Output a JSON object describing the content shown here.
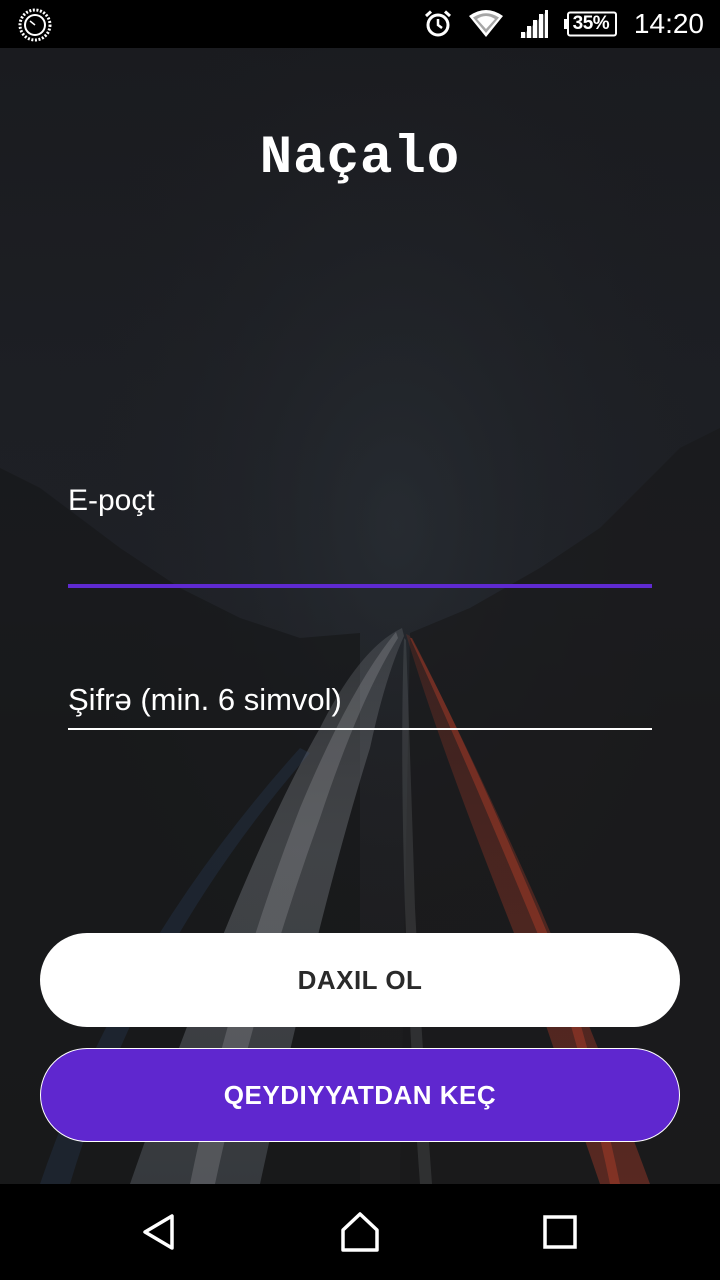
{
  "status_bar": {
    "time": "14:20",
    "battery_percent": "35%",
    "icons": [
      "app-notification-icon",
      "alarm-icon",
      "wifi-icon",
      "cellular-signal-icon",
      "battery-icon"
    ]
  },
  "app": {
    "title": "Naçalo"
  },
  "form": {
    "email": {
      "label": "E-poçt",
      "value": "",
      "focused": true
    },
    "password": {
      "placeholder": "Şifrə (min. 6 simvol)",
      "value": ""
    }
  },
  "buttons": {
    "login_label": "DAXIL OL",
    "register_label": "QEYDIYYATDAN KEÇ"
  },
  "nav_bar": {
    "icons": [
      "back-icon",
      "home-icon",
      "recent-apps-icon"
    ]
  },
  "colors": {
    "accent": "#5f27cf",
    "status_bar_bg": "#000000",
    "nav_bar_bg": "#000000",
    "login_button_bg": "#ffffff",
    "login_button_text": "#2a2a2a"
  }
}
